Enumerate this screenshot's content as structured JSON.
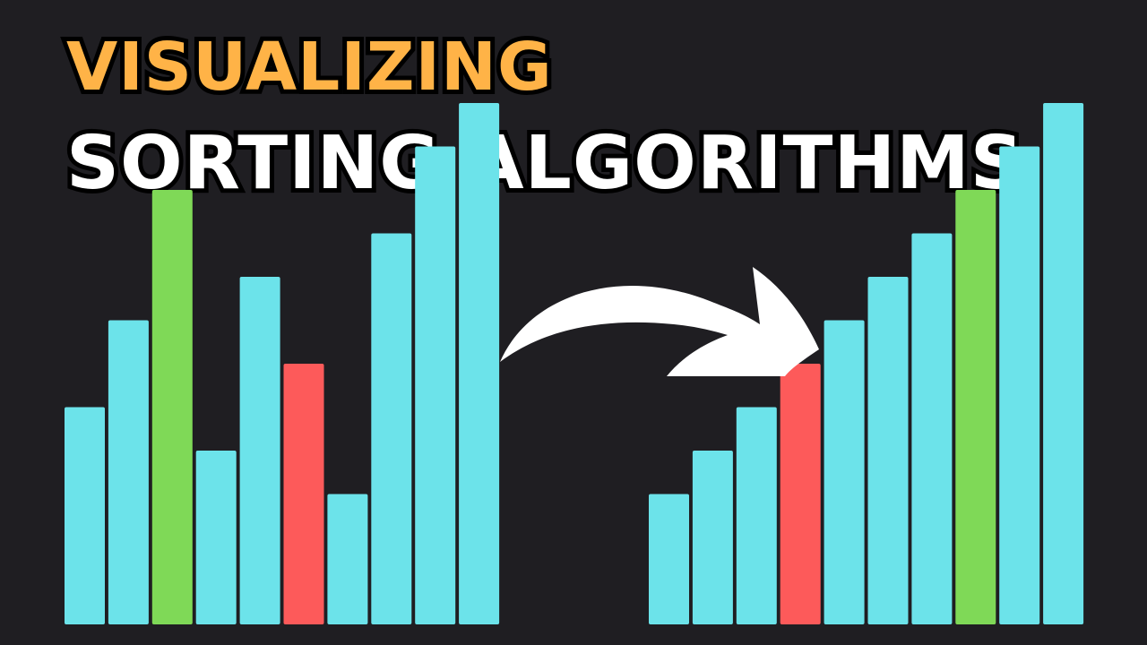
{
  "title": {
    "line1": "VISUALIZING",
    "line2": "SORTING ALGORITHMS",
    "line1_color": "#ffb347",
    "line2_color": "#ffffff"
  },
  "colors": {
    "background": "#1f1e22",
    "default_bar": "#6ce3ea",
    "highlight_green": "#7fd957",
    "highlight_red": "#fd5a5a",
    "arrow": "#ffffff"
  },
  "unsorted_bars": [
    {
      "value": 5,
      "color": "#6ce3ea"
    },
    {
      "value": 7,
      "color": "#6ce3ea"
    },
    {
      "value": 10,
      "color": "#7fd957"
    },
    {
      "value": 4,
      "color": "#6ce3ea"
    },
    {
      "value": 8,
      "color": "#6ce3ea"
    },
    {
      "value": 6,
      "color": "#fd5a5a"
    },
    {
      "value": 3,
      "color": "#6ce3ea"
    },
    {
      "value": 9,
      "color": "#6ce3ea"
    },
    {
      "value": 11,
      "color": "#6ce3ea"
    },
    {
      "value": 12,
      "color": "#6ce3ea"
    }
  ],
  "sorted_bars": [
    {
      "value": 3,
      "color": "#6ce3ea"
    },
    {
      "value": 4,
      "color": "#6ce3ea"
    },
    {
      "value": 5,
      "color": "#6ce3ea"
    },
    {
      "value": 6,
      "color": "#fd5a5a"
    },
    {
      "value": 7,
      "color": "#6ce3ea"
    },
    {
      "value": 8,
      "color": "#6ce3ea"
    },
    {
      "value": 9,
      "color": "#6ce3ea"
    },
    {
      "value": 10,
      "color": "#7fd957"
    },
    {
      "value": 11,
      "color": "#6ce3ea"
    },
    {
      "value": 12,
      "color": "#6ce3ea"
    }
  ],
  "arrow_icon": "curved-arrow-right-icon"
}
